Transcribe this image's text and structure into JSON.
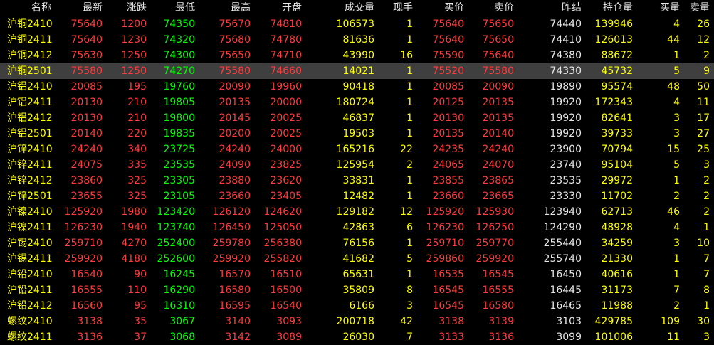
{
  "colors": {
    "up": "#ff3b3b",
    "down": "#00ff00",
    "neutral": "#e6e6e6",
    "volume": "#ffff00",
    "selected_row_bg": "#3f3f3f"
  },
  "columns": [
    "名称",
    "最新",
    "涨跌",
    "最低",
    "最高",
    "开盘",
    "成交量",
    "现手",
    "买价",
    "卖价",
    "昨结",
    "持仓量",
    "买量",
    "卖量"
  ],
  "selected_index": 3,
  "rows": [
    [
      "沪铜2410",
      "75640",
      "1200",
      "74350",
      "75670",
      "74810",
      "106573",
      "1",
      "75640",
      "75650",
      "74440",
      "139946",
      "4",
      "26"
    ],
    [
      "沪铜2411",
      "75640",
      "1230",
      "74320",
      "75680",
      "74780",
      "81636",
      "1",
      "75640",
      "75650",
      "74410",
      "126013",
      "44",
      "12"
    ],
    [
      "沪铜2412",
      "75630",
      "1250",
      "74300",
      "75650",
      "74710",
      "43990",
      "16",
      "75590",
      "75640",
      "74380",
      "88672",
      "1",
      "2"
    ],
    [
      "沪铜2501",
      "75580",
      "1250",
      "74270",
      "75580",
      "74660",
      "14021",
      "1",
      "75520",
      "75580",
      "74330",
      "45732",
      "5",
      "9"
    ],
    [
      "沪铝2410",
      "20085",
      "195",
      "19760",
      "20090",
      "19960",
      "90418",
      "1",
      "20085",
      "20090",
      "19890",
      "95574",
      "48",
      "50"
    ],
    [
      "沪铝2411",
      "20130",
      "210",
      "19805",
      "20135",
      "20000",
      "180724",
      "1",
      "20125",
      "20135",
      "19920",
      "172343",
      "4",
      "11"
    ],
    [
      "沪铝2412",
      "20130",
      "210",
      "19800",
      "20145",
      "20025",
      "46837",
      "1",
      "20130",
      "20135",
      "19920",
      "82641",
      "3",
      "17"
    ],
    [
      "沪铝2501",
      "20140",
      "220",
      "19835",
      "20200",
      "20025",
      "19503",
      "1",
      "20135",
      "20140",
      "19920",
      "39733",
      "3",
      "27"
    ],
    [
      "沪锌2410",
      "24240",
      "340",
      "23725",
      "24240",
      "24000",
      "165216",
      "22",
      "24235",
      "24240",
      "23900",
      "70794",
      "15",
      "25"
    ],
    [
      "沪锌2411",
      "24075",
      "335",
      "23535",
      "24090",
      "23825",
      "125954",
      "2",
      "24065",
      "24070",
      "23740",
      "95104",
      "5",
      "3"
    ],
    [
      "沪锌2412",
      "23860",
      "325",
      "23305",
      "23880",
      "23620",
      "33831",
      "1",
      "23855",
      "23865",
      "23535",
      "29972",
      "1",
      "2"
    ],
    [
      "沪锌2501",
      "23655",
      "325",
      "23105",
      "23660",
      "23405",
      "12482",
      "1",
      "23660",
      "23665",
      "23330",
      "11702",
      "2",
      "2"
    ],
    [
      "沪镍2410",
      "125920",
      "1980",
      "123420",
      "126120",
      "124620",
      "129182",
      "12",
      "125920",
      "125930",
      "123940",
      "62713",
      "46",
      "2"
    ],
    [
      "沪镍2411",
      "126230",
      "1940",
      "123740",
      "126450",
      "125050",
      "42863",
      "6",
      "126230",
      "126250",
      "124290",
      "48928",
      "4",
      "1"
    ],
    [
      "沪锡2410",
      "259710",
      "4270",
      "252400",
      "259780",
      "256380",
      "76156",
      "1",
      "259710",
      "259770",
      "255440",
      "34259",
      "3",
      "10"
    ],
    [
      "沪锡2411",
      "259920",
      "4180",
      "252600",
      "259920",
      "255820",
      "41682",
      "5",
      "259860",
      "259920",
      "255740",
      "21330",
      "1",
      "7"
    ],
    [
      "沪铅2410",
      "16540",
      "90",
      "16245",
      "16570",
      "16510",
      "65631",
      "1",
      "16535",
      "16545",
      "16450",
      "40616",
      "1",
      "7"
    ],
    [
      "沪铅2411",
      "16555",
      "110",
      "16290",
      "16580",
      "16500",
      "35809",
      "8",
      "16545",
      "16555",
      "16445",
      "31173",
      "7",
      "8"
    ],
    [
      "沪铅2412",
      "16560",
      "95",
      "16310",
      "16595",
      "16540",
      "6166",
      "3",
      "16545",
      "16580",
      "16465",
      "11988",
      "2",
      "1"
    ],
    [
      "螺纹2410",
      "3138",
      "35",
      "3067",
      "3140",
      "3093",
      "200718",
      "42",
      "3138",
      "3139",
      "3103",
      "429785",
      "109",
      "30"
    ],
    [
      "螺纹2411",
      "3136",
      "37",
      "3068",
      "3142",
      "3089",
      "26030",
      "7",
      "3133",
      "3136",
      "3099",
      "101006",
      "11",
      "3"
    ]
  ]
}
